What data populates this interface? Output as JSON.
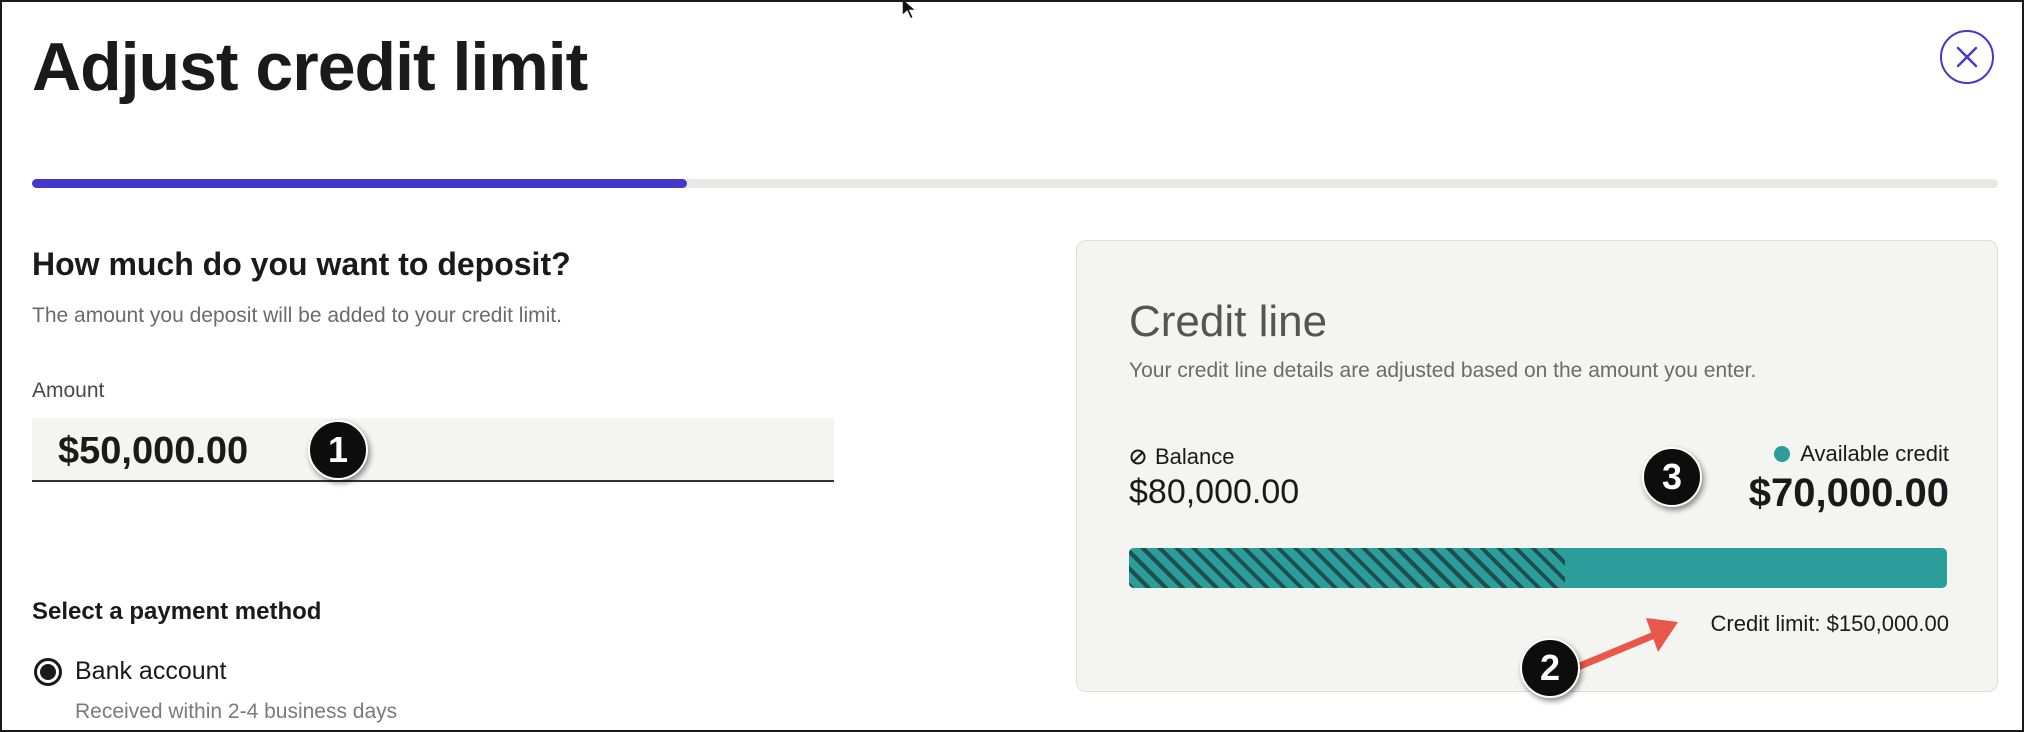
{
  "header": {
    "title": "Adjust credit limit",
    "close_icon": "close-icon",
    "accent_color": "#4338ca"
  },
  "progress": {
    "fraction": 0.333
  },
  "deposit": {
    "question": "How much do you want to deposit?",
    "subtitle": "The amount you deposit will be added to your credit limit.",
    "amount_label": "Amount",
    "amount_value": "$50,000.00"
  },
  "payment": {
    "label": "Select a payment method",
    "options": [
      {
        "label": "Bank account",
        "sublabel": "Received within 2-4 business days",
        "selected": true
      }
    ]
  },
  "credit_line": {
    "title": "Credit line",
    "subtitle": "Your credit line details are adjusted based on the amount you enter.",
    "balance_label": "Balance",
    "balance_value": "$80,000.00",
    "balance_icon": "slashed-circle-icon",
    "available_label": "Available credit",
    "available_value": "$70,000.00",
    "limit_text": "Credit limit: $150,000.00",
    "used_fraction": 0.533,
    "bar_color": "#2b9d9a"
  },
  "annotations": {
    "badge_1": "1",
    "badge_2": "2",
    "badge_3": "3",
    "arrow_color": "#e8574a"
  }
}
